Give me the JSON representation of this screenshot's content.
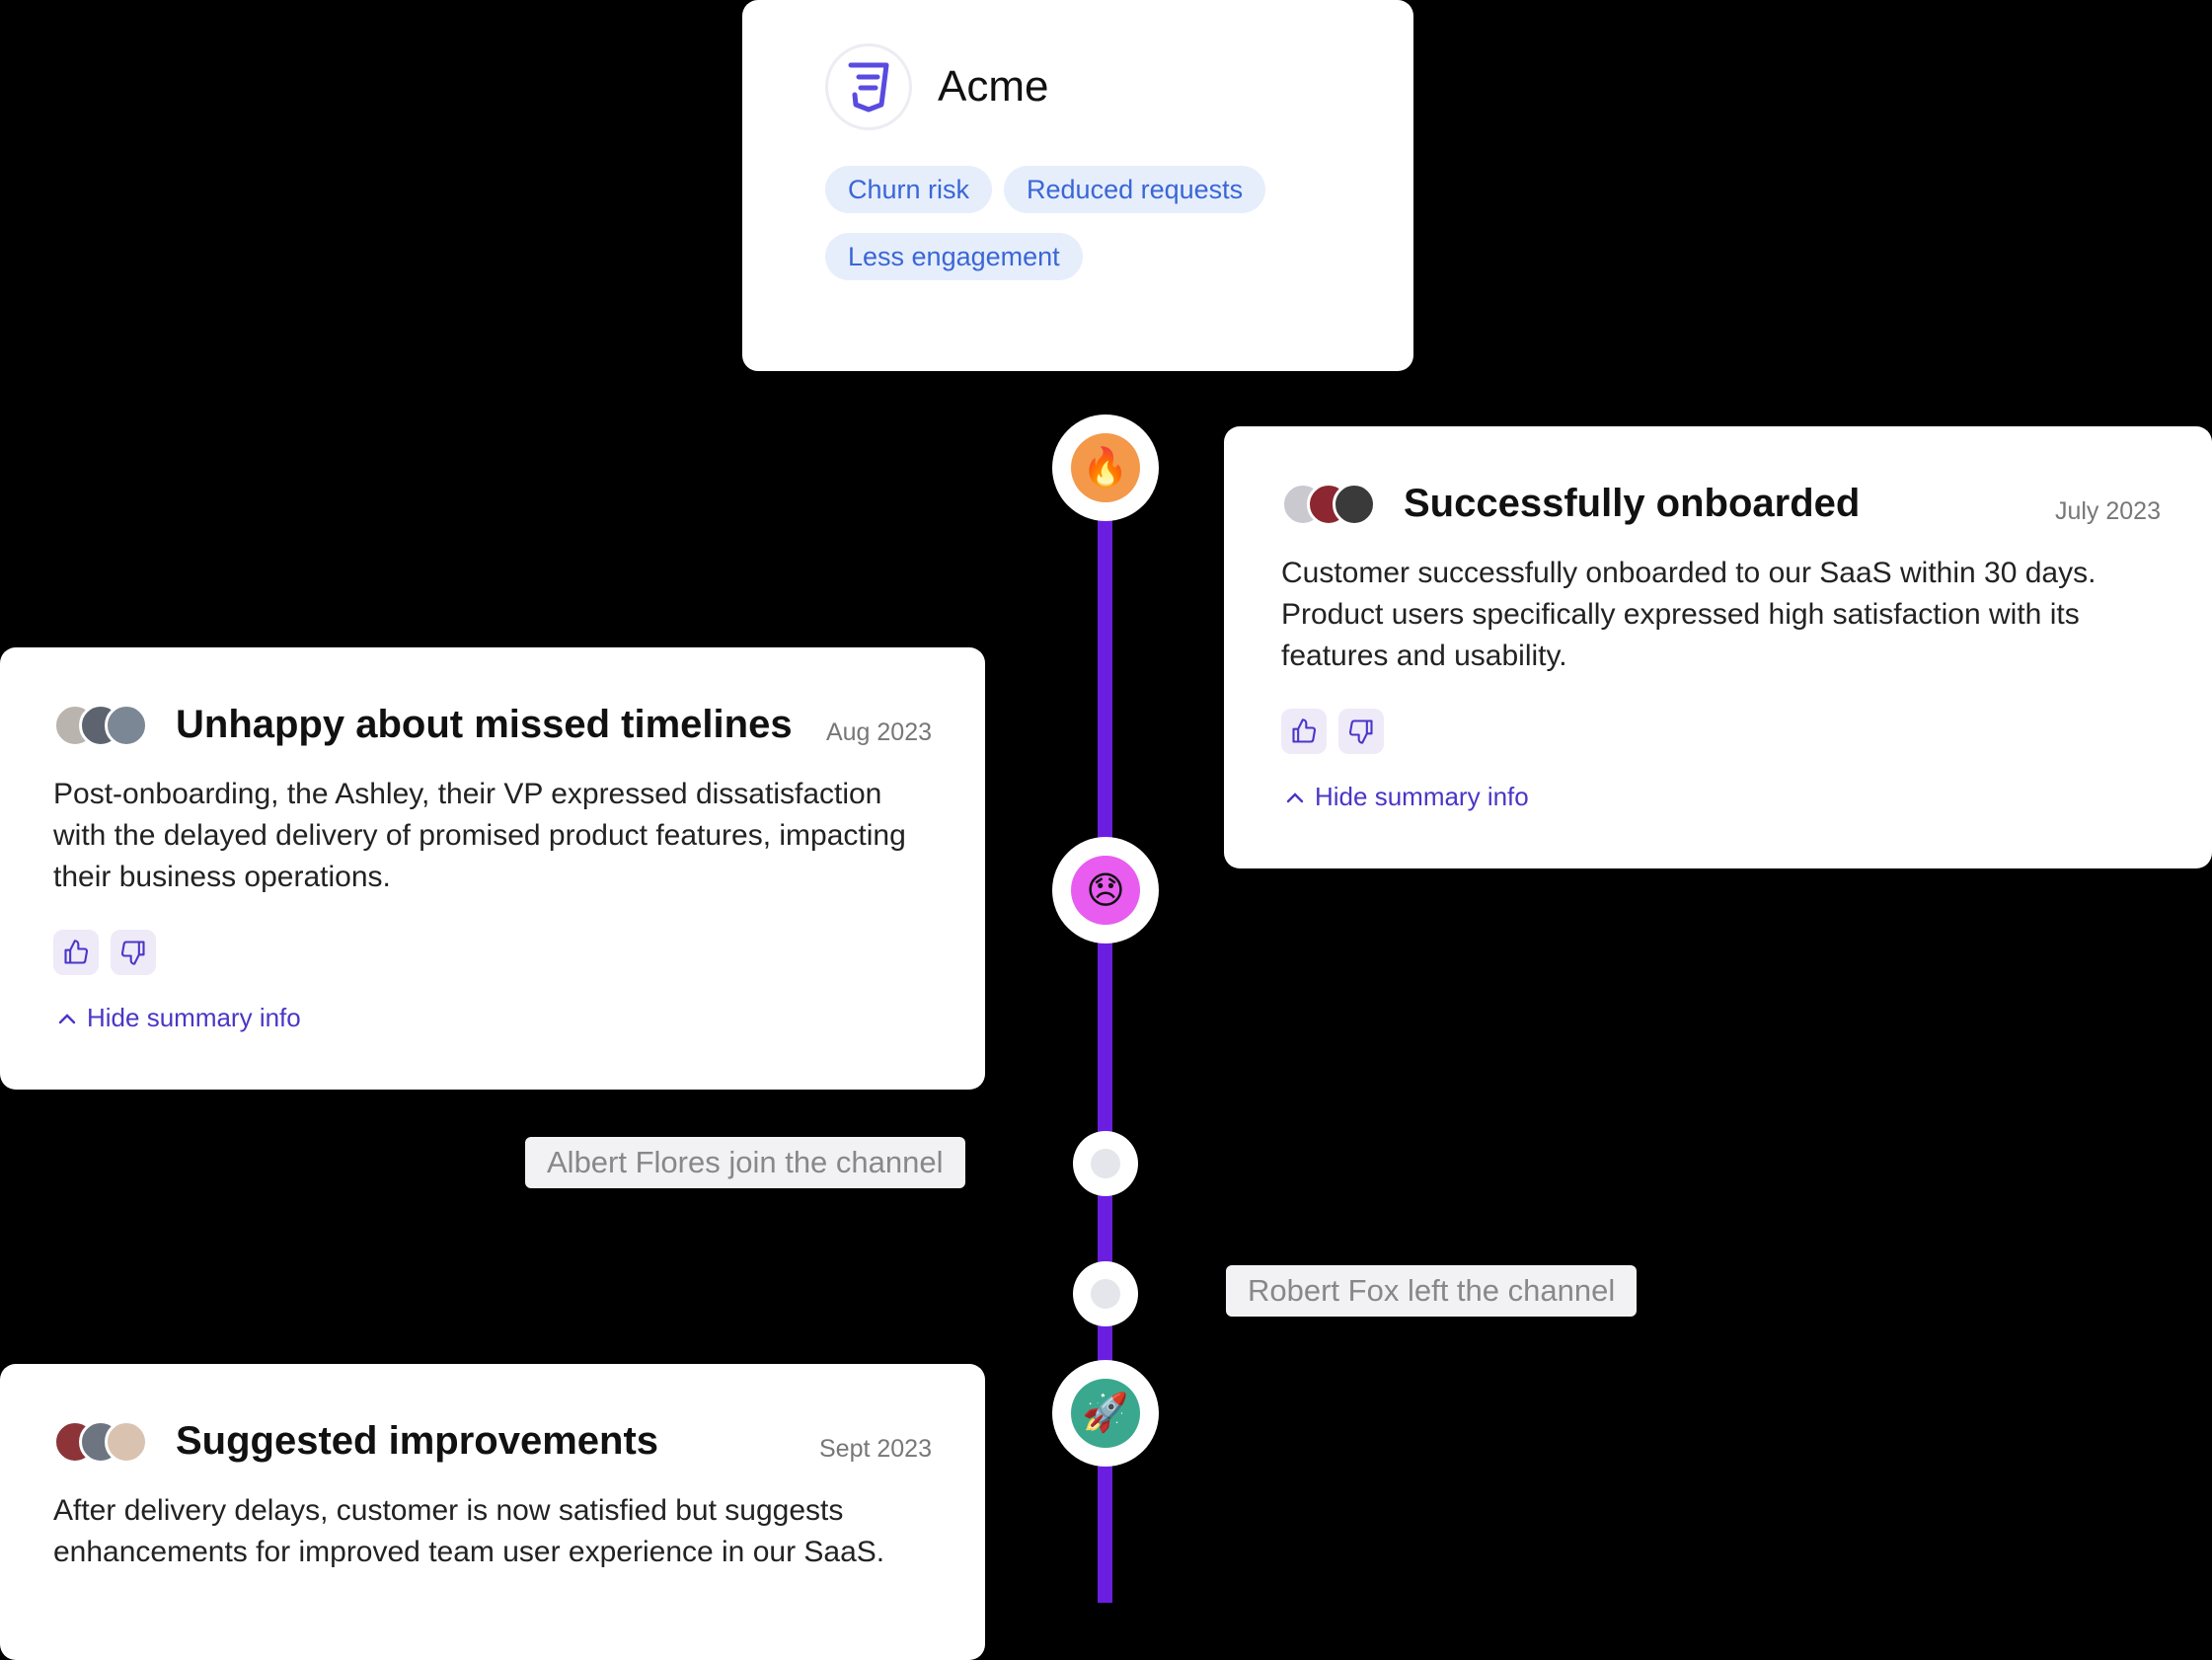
{
  "company": {
    "name": "Acme",
    "logo_icon": "css3-icon",
    "tags": [
      "Churn risk",
      "Reduced requests",
      "Less engagement"
    ]
  },
  "nodes": {
    "onboarded_icon": "🔥",
    "unhappy_icon": "😞",
    "improvements_icon": "🚀"
  },
  "events": {
    "onboarded": {
      "title": "Successfully onboarded",
      "date": "July 2023",
      "body": "Customer successfully onboarded to our SaaS within 30 days. Product users specifically expressed high satisfaction with its features and usability.",
      "summary_link": "Hide summary info"
    },
    "unhappy": {
      "title": "Unhappy about missed timelines",
      "date": "Aug 2023",
      "body": "Post-onboarding, the Ashley, their VP expressed dissatisfaction with the delayed delivery of promised product features, impacting their business operations.",
      "summary_link": "Hide summary info"
    },
    "improvements": {
      "title": "Suggested improvements",
      "date": "Sept 2023",
      "body": "After delivery delays, customer is now satisfied but suggests enhancements for improved team user experience in our SaaS."
    }
  },
  "channel_notes": {
    "joined": "Albert Flores join the channel",
    "left": "Robert Fox left the channel"
  },
  "colors": {
    "timeline": "#6a1fe0",
    "node_fire": "#f4984a",
    "node_sad": "#e85cf0",
    "node_rocket": "#3aa88e",
    "tag_bg": "#e6eefc",
    "tag_text": "#3a66d6",
    "link": "#4a36c8"
  }
}
